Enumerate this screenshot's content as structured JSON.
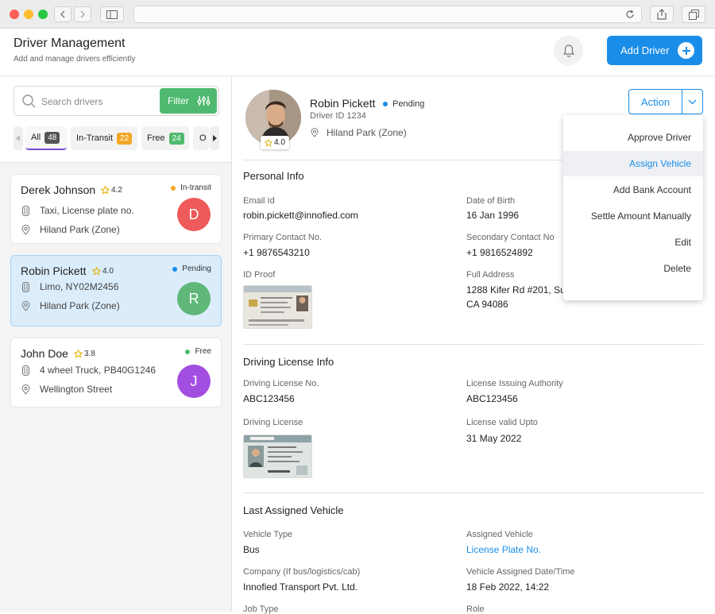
{
  "header": {
    "title": "Driver Management",
    "subtitle": "Add and manage drivers efficiently",
    "add_driver_label": "Add Driver"
  },
  "search": {
    "placeholder": "Search drivers",
    "value": "",
    "filter_label": "Filter"
  },
  "chips": [
    {
      "label": "All",
      "count": "48",
      "active": true
    },
    {
      "label": "In-Transit",
      "count": "22"
    },
    {
      "label": "Free",
      "count": "24"
    },
    {
      "label": "O"
    }
  ],
  "drivers": [
    {
      "name": "Derek Johnson",
      "rating": "4.2",
      "status": "In-transit",
      "status_color": "#f2a623",
      "vehicle": "Taxi, License plate no.",
      "zone": "Hiland Park (Zone)",
      "initial": "D",
      "avatar_color": "#ef5a5a"
    },
    {
      "name": "Robin Pickett",
      "rating": "4.0",
      "status": "Pending",
      "status_color": "#1a8de8",
      "vehicle": "Limo, NY02M2456",
      "zone": "Hiland Park (Zone)",
      "initial": "R",
      "avatar_color": "#5fb87a",
      "selected": true
    },
    {
      "name": "John Doe",
      "rating": "3.8",
      "status": "Free",
      "status_color": "#4fba6f",
      "vehicle": "4 wheel Truck, PB40G1246",
      "zone": "Wellington Street",
      "initial": "J",
      "avatar_color": "#a24ee0"
    }
  ],
  "profile": {
    "name": "Robin Pickett",
    "status": "Pending",
    "driver_id": "Driver ID 1234",
    "zone": "Hiland Park (Zone)",
    "rating": "4.0",
    "action_label": "Action"
  },
  "action_menu": [
    "Approve Driver",
    "Assign Vehicle",
    "Add Bank Account",
    "Settle Amount Manually",
    "Edit",
    "Delete"
  ],
  "action_menu_highlight": "Assign Vehicle",
  "personal_info": {
    "title": "Personal Info",
    "email_label": "Email Id",
    "email": "robin.pickett@innofied.com",
    "dob_label": "Date of Birth",
    "dob": "16 Jan 1996",
    "primary_label": "Primary Contact No.",
    "primary": "+1 9876543210",
    "secondary_label": "Secondary Contact No",
    "secondary": "+1 9816524892",
    "id_proof_label": "ID Proof",
    "address_label": "Full Address",
    "address_line1": "1288 Kifer Rd #201, Su",
    "address_line2": "CA 94086"
  },
  "license_info": {
    "title": "Driving License Info",
    "license_no_label": "Driving License No.",
    "license_no": "ABC123456",
    "authority_label": "License Issuing Authority",
    "authority": "ABC123456",
    "license_label": "Driving License",
    "valid_label": "License valid Upto",
    "valid": "31 May 2022"
  },
  "vehicle_info": {
    "title": "Last Assigned Vehicle",
    "type_label": "Vehicle Type",
    "type": "Bus",
    "assigned_label": "Assigned Vehicle",
    "assigned": "License Plate No.",
    "company_label": "Company (If bus/logistics/cab)",
    "company": "Innofied Transport Pvt. Ltd.",
    "date_label": "Vehicle Assigned Date/Time",
    "date": "18 Feb 2022, 14:22",
    "job_label": "Job Type",
    "role_label": "Role"
  }
}
